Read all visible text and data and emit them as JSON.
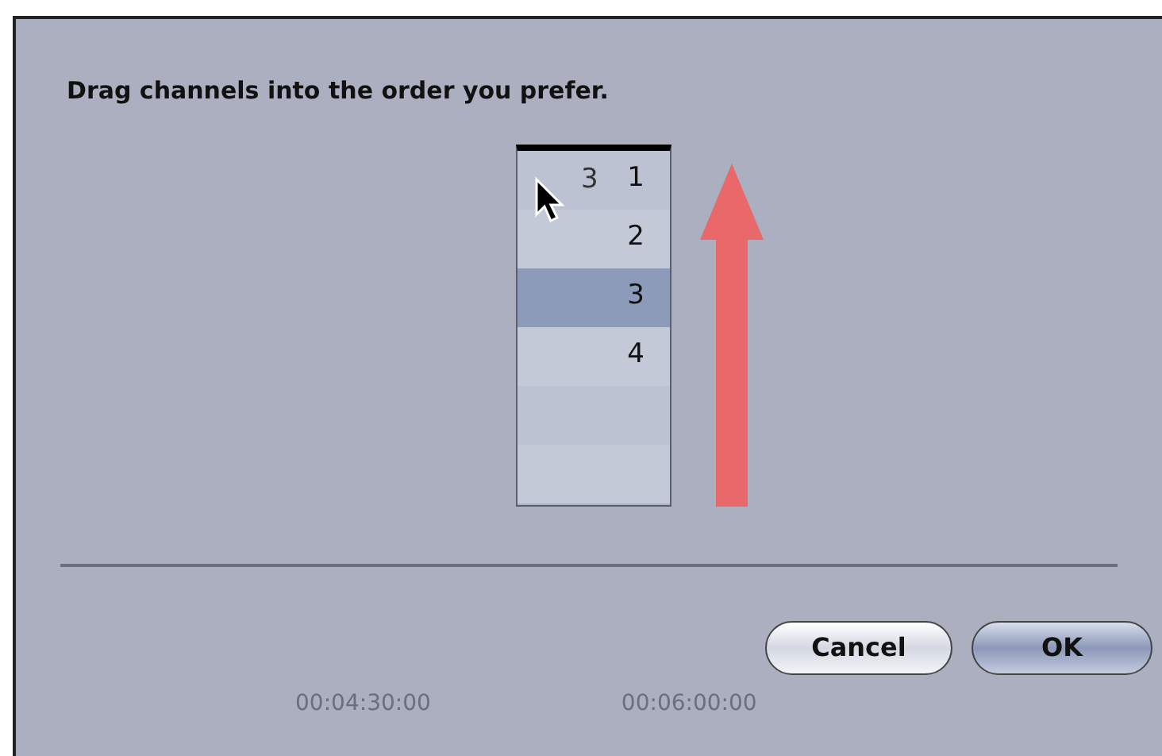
{
  "dialog": {
    "message": "Drag channels into the order you prefer."
  },
  "channel_list": {
    "drag_label": "3",
    "rows": [
      {
        "label": "1",
        "selected": false
      },
      {
        "label": "2",
        "selected": false
      },
      {
        "label": "3",
        "selected": true
      },
      {
        "label": "4",
        "selected": false
      },
      {
        "selected": false
      },
      {
        "selected": false
      }
    ]
  },
  "buttons": [
    {
      "label": "Cancel",
      "kind": "normal"
    },
    {
      "label": "OK",
      "kind": "default"
    }
  ],
  "background_timecodes": [
    "00:04:30:00",
    "00:06:00:00"
  ]
}
